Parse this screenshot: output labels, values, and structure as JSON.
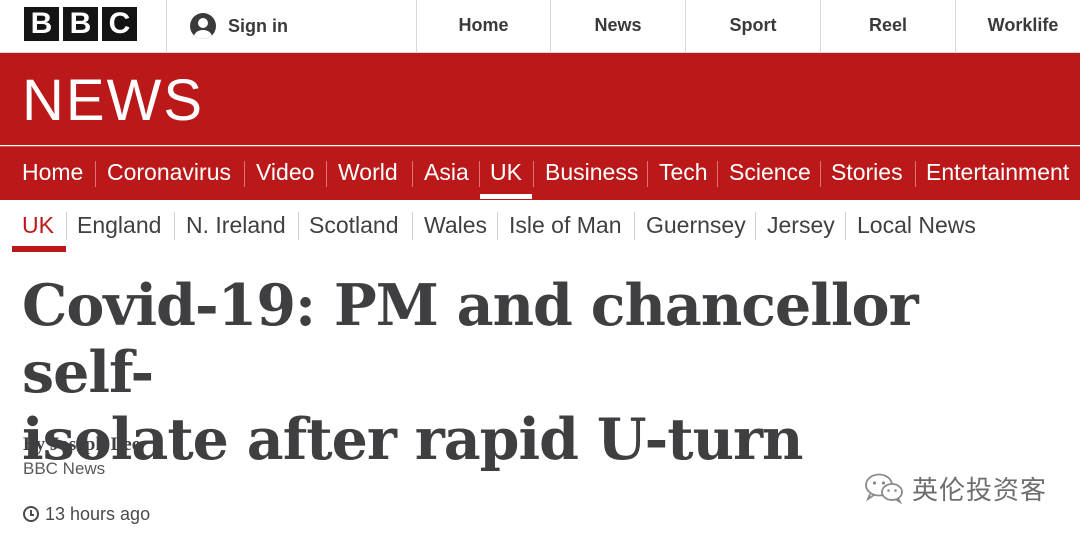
{
  "topbar": {
    "logo_letters": [
      "B",
      "B",
      "C"
    ],
    "signin_label": "Sign in",
    "nav": [
      "Home",
      "News",
      "Sport",
      "Reel",
      "Worklife"
    ]
  },
  "banner": {
    "wordmark": "NEWS",
    "color": "#bb1919"
  },
  "section_nav": {
    "items": [
      "Home",
      "Coronavirus",
      "Video",
      "World",
      "Asia",
      "UK",
      "Business",
      "Tech",
      "Science",
      "Stories",
      "Entertainment"
    ],
    "active": "UK"
  },
  "sub_nav": {
    "items": [
      "UK",
      "England",
      "N. Ireland",
      "Scotland",
      "Wales",
      "Isle of Man",
      "Guernsey",
      "Jersey",
      "Local News"
    ],
    "active": "UK"
  },
  "article": {
    "headline_line1": "Covid-19: PM and chancellor self-",
    "headline_line2": "isolate after rapid U-turn",
    "author": "By Joseph Lee",
    "organisation": "BBC News",
    "timestamp": "13 hours ago"
  },
  "watermark": {
    "text": "英伦投资客",
    "icon": "wechat-icon"
  }
}
